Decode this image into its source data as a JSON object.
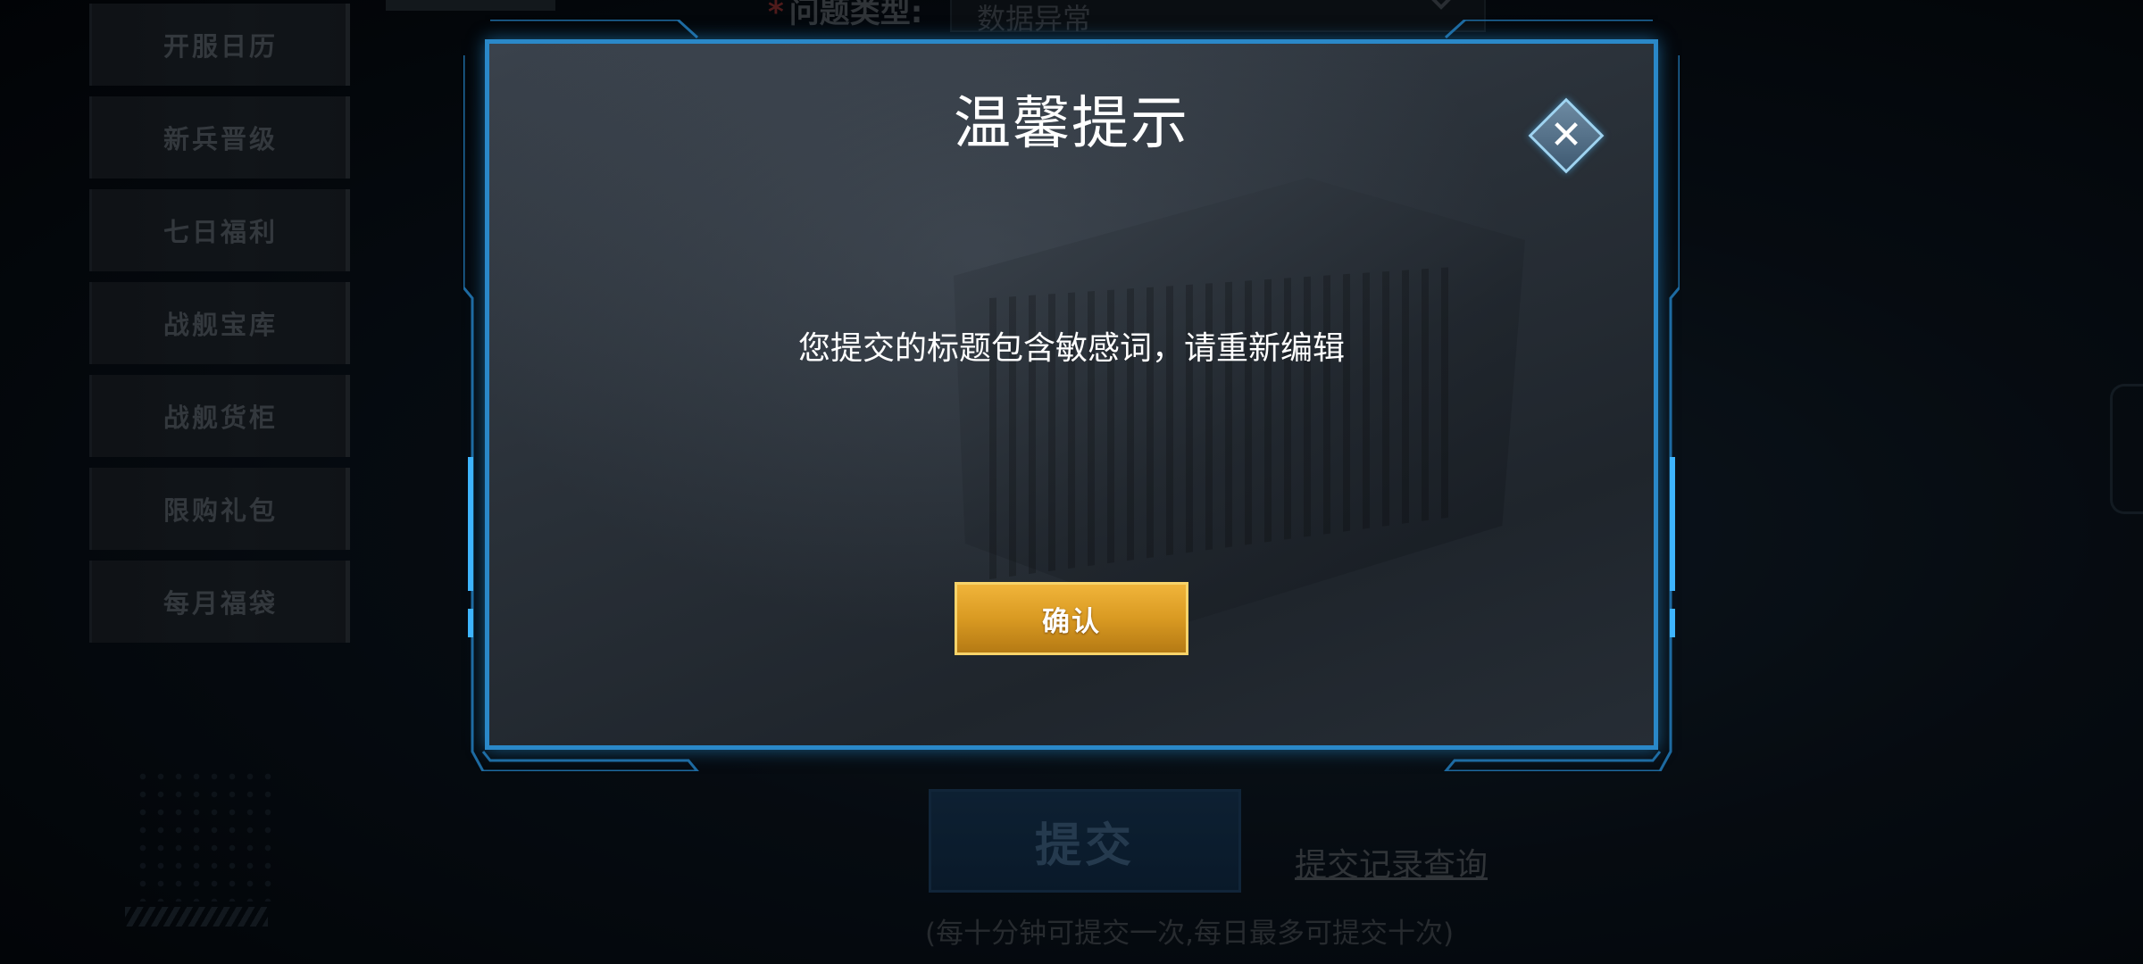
{
  "sidebar": {
    "items": [
      {
        "label": "开服日历"
      },
      {
        "label": "新兵晋级"
      },
      {
        "label": "七日福利"
      },
      {
        "label": "战舰宝库"
      },
      {
        "label": "战舰货柜"
      },
      {
        "label": "限购礼包"
      },
      {
        "label": "每月福袋"
      }
    ]
  },
  "form": {
    "required_mark": "*",
    "question_type_label": "问题类型:",
    "question_type_value": "数据异常",
    "submit_label": "提交",
    "record_link": "提交记录查询",
    "limit_hint": "(每十分钟可提交一次,每日最多可提交十次)"
  },
  "dialog": {
    "title": "温馨提示",
    "message": "您提交的标题包含敏感词，请重新编辑",
    "confirm_label": "确认",
    "close_symbol": "✕"
  },
  "colors": {
    "frame_blue": "#2a88c8",
    "confirm_gold": "#e0a42c"
  },
  "icons": {
    "close": "close-icon",
    "dropdown": "chevron-down-icon"
  }
}
